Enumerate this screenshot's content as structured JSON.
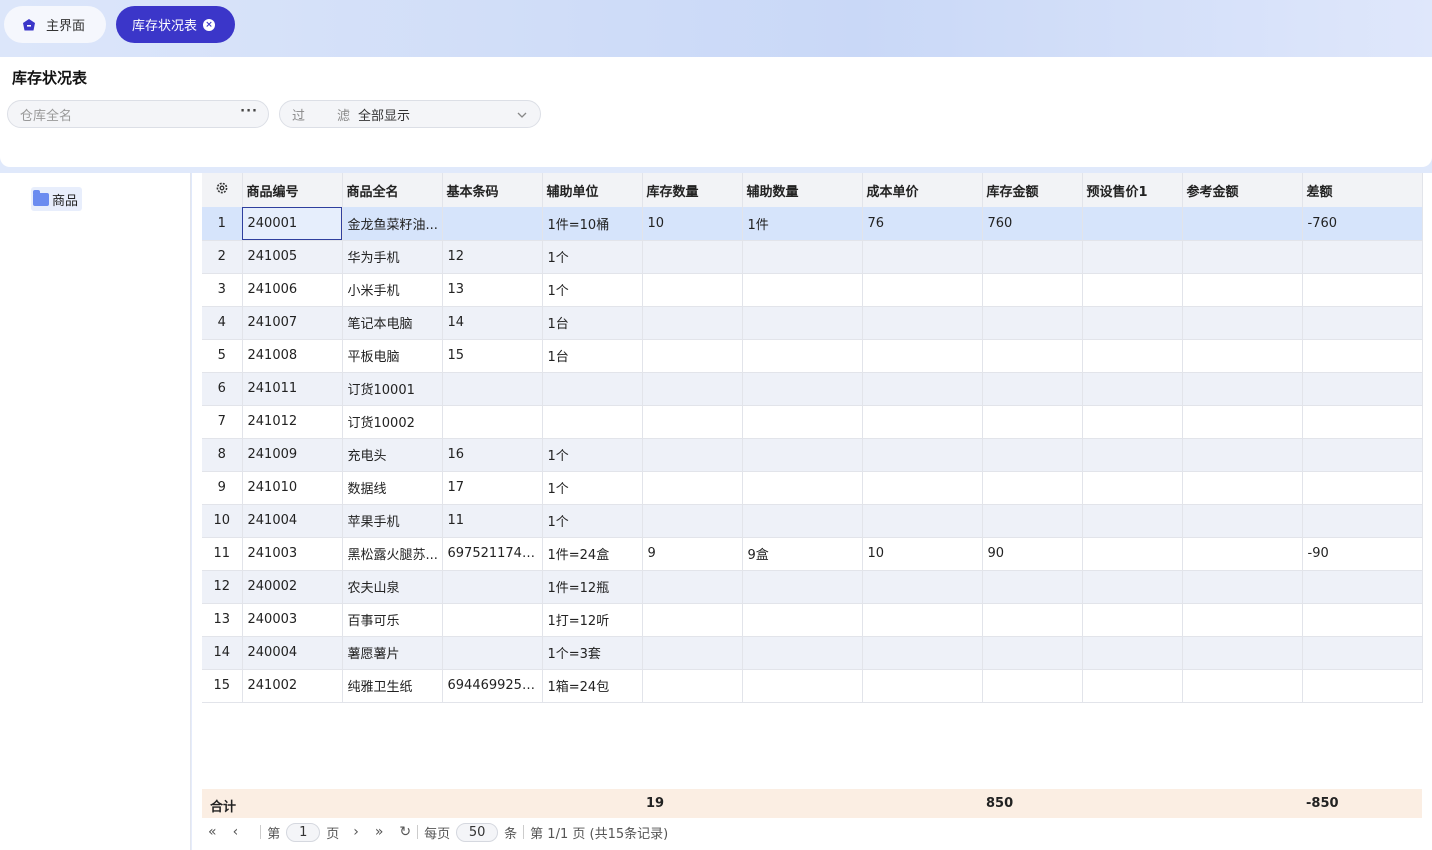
{
  "tabs": [
    {
      "label": "主界面",
      "icon": "home-icon"
    },
    {
      "label": "库存状况表",
      "icon": "close-icon"
    }
  ],
  "header": {
    "title": "库存状况表",
    "warehouse_placeholder": "仓库全名",
    "warehouse_button": "···",
    "filter_label_a": "过",
    "filter_label_b": "滤",
    "filter_value": "全部显示"
  },
  "tree": {
    "root": "商品"
  },
  "table": {
    "columns": [
      "商品编号",
      "商品全名",
      "基本条码",
      "辅助单位",
      "库存数量",
      "辅助数量",
      "成本单价",
      "库存金额",
      "预设售价1",
      "参考金额",
      "差额"
    ],
    "rows": [
      {
        "n": "1",
        "code": "240001",
        "name": "金龙鱼菜籽油...",
        "barcode": "",
        "unit": "1件=10桶",
        "qty": "10",
        "aux_qty": "1件",
        "cost": "76",
        "amount": "760",
        "price1": "",
        "ref": "",
        "diff": "-760"
      },
      {
        "n": "2",
        "code": "241005",
        "name": "华为手机",
        "barcode": "12",
        "unit": "1个",
        "qty": "",
        "aux_qty": "",
        "cost": "",
        "amount": "",
        "price1": "",
        "ref": "",
        "diff": ""
      },
      {
        "n": "3",
        "code": "241006",
        "name": "小米手机",
        "barcode": "13",
        "unit": "1个",
        "qty": "",
        "aux_qty": "",
        "cost": "",
        "amount": "",
        "price1": "",
        "ref": "",
        "diff": ""
      },
      {
        "n": "4",
        "code": "241007",
        "name": "笔记本电脑",
        "barcode": "14",
        "unit": "1台",
        "qty": "",
        "aux_qty": "",
        "cost": "",
        "amount": "",
        "price1": "",
        "ref": "",
        "diff": ""
      },
      {
        "n": "5",
        "code": "241008",
        "name": "平板电脑",
        "barcode": "15",
        "unit": "1台",
        "qty": "",
        "aux_qty": "",
        "cost": "",
        "amount": "",
        "price1": "",
        "ref": "",
        "diff": ""
      },
      {
        "n": "6",
        "code": "241011",
        "name": "订货10001",
        "barcode": "",
        "unit": "",
        "qty": "",
        "aux_qty": "",
        "cost": "",
        "amount": "",
        "price1": "",
        "ref": "",
        "diff": ""
      },
      {
        "n": "7",
        "code": "241012",
        "name": "订货10002",
        "barcode": "",
        "unit": "",
        "qty": "",
        "aux_qty": "",
        "cost": "",
        "amount": "",
        "price1": "",
        "ref": "",
        "diff": ""
      },
      {
        "n": "8",
        "code": "241009",
        "name": "充电头",
        "barcode": "16",
        "unit": "1个",
        "qty": "",
        "aux_qty": "",
        "cost": "",
        "amount": "",
        "price1": "",
        "ref": "",
        "diff": ""
      },
      {
        "n": "9",
        "code": "241010",
        "name": "数据线",
        "barcode": "17",
        "unit": "1个",
        "qty": "",
        "aux_qty": "",
        "cost": "",
        "amount": "",
        "price1": "",
        "ref": "",
        "diff": ""
      },
      {
        "n": "10",
        "code": "241004",
        "name": "苹果手机",
        "barcode": "11",
        "unit": "1个",
        "qty": "",
        "aux_qty": "",
        "cost": "",
        "amount": "",
        "price1": "",
        "ref": "",
        "diff": ""
      },
      {
        "n": "11",
        "code": "241003",
        "name": "黑松露火腿苏...",
        "barcode": "6975211740...",
        "unit": "1件=24盒",
        "qty": "9",
        "aux_qty": "9盒",
        "cost": "10",
        "amount": "90",
        "price1": "",
        "ref": "",
        "diff": "-90"
      },
      {
        "n": "12",
        "code": "240002",
        "name": "农夫山泉",
        "barcode": "",
        "unit": "1件=12瓶",
        "qty": "",
        "aux_qty": "",
        "cost": "",
        "amount": "",
        "price1": "",
        "ref": "",
        "diff": ""
      },
      {
        "n": "13",
        "code": "240003",
        "name": "百事可乐",
        "barcode": "",
        "unit": "1打=12听",
        "qty": "",
        "aux_qty": "",
        "cost": "",
        "amount": "",
        "price1": "",
        "ref": "",
        "diff": ""
      },
      {
        "n": "14",
        "code": "240004",
        "name": "薯愿薯片",
        "barcode": "",
        "unit": "1个=3套",
        "qty": "",
        "aux_qty": "",
        "cost": "",
        "amount": "",
        "price1": "",
        "ref": "",
        "diff": ""
      },
      {
        "n": "15",
        "code": "241002",
        "name": "纯雅卫生纸",
        "barcode": "6944699253...",
        "unit": "1箱=24包",
        "qty": "",
        "aux_qty": "",
        "cost": "",
        "amount": "",
        "price1": "",
        "ref": "",
        "diff": ""
      }
    ]
  },
  "totals": {
    "label": "合计",
    "qty": "19",
    "amount": "850",
    "diff": "-850"
  },
  "pager": {
    "first": "«",
    "prev": "‹",
    "page_prefix": "第",
    "page": "1",
    "page_suffix": "页",
    "next": "›",
    "last": "»",
    "refresh": "↻",
    "per_prefix": "每页",
    "per": "50",
    "per_suffix": "条",
    "summary": "第 1/1 页 (共15条记录)"
  }
}
